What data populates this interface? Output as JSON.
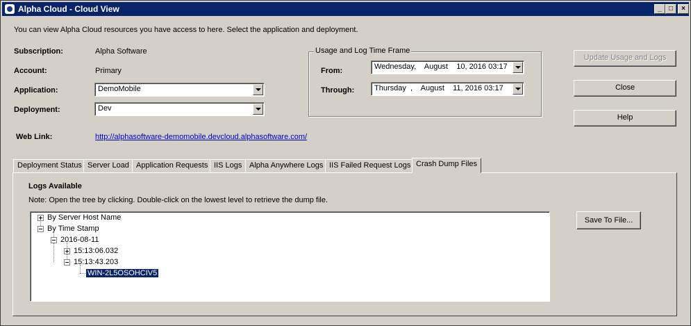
{
  "window": {
    "title": "Alpha Cloud - Cloud View",
    "controls": [
      "_",
      "□",
      "×"
    ]
  },
  "intro": "You can view Alpha Cloud resources you have access to here.  Select the application and deployment.",
  "fields": {
    "subscription_label": "Subscription:",
    "subscription_value": "Alpha Software",
    "account_label": "Account:",
    "account_value": "Primary",
    "application_label": "Application:",
    "application_value": "DemoMobile",
    "deployment_label": "Deployment:",
    "deployment_value": "Dev",
    "weblink_label": "Web Link:",
    "weblink_value": "http://alphasoftware-demomobile.devcloud.alphasoftware.com/"
  },
  "timeframe": {
    "legend": "Usage and Log Time Frame",
    "from_label": "From:",
    "from_value": "Wednesday,    August    10, 2016 03:17",
    "through_label": "Through:",
    "through_value": "Thursday  ,    August    11, 2016 03:17"
  },
  "buttons": {
    "update": "Update Usage and Logs",
    "close": "Close",
    "help": "Help",
    "save": "Save To File..."
  },
  "tabs": [
    "Deployment Status",
    "Server Load",
    "Application Requests",
    "IIS Logs",
    "Alpha Anywhere Logs",
    "IIS Failed Request Logs",
    "Crash Dump Files"
  ],
  "active_tab": "Crash Dump Files",
  "panel": {
    "heading": "Logs Available",
    "note": "Note: Open the tree by clicking.  Double-click on the lowest level to retrieve the dump file."
  },
  "tree": [
    {
      "label": "By Server Host Name",
      "expanded": false
    },
    {
      "label": "By Time Stamp",
      "expanded": true
    },
    {
      "label": "2016-08-11",
      "expanded": true
    },
    {
      "label": "15:13:06.032",
      "expanded": false
    },
    {
      "label": "15:13:43.203",
      "expanded": true
    },
    {
      "label": "WIN-2L5OSOHCIV5",
      "selected": true
    }
  ],
  "colors": {
    "titlebar": "#0a246a",
    "face": "#d4d0c8",
    "link": "#0000cc",
    "selection": "#0a246a"
  }
}
